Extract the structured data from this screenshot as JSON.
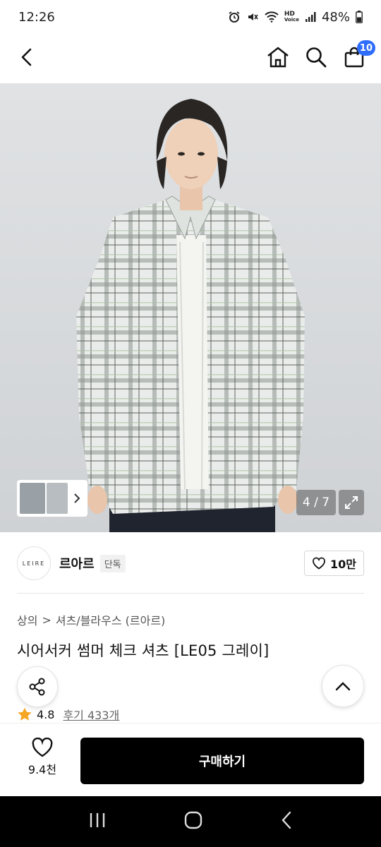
{
  "status_bar": {
    "time": "12:26",
    "network": "HD",
    "network_sub": "Voice",
    "battery": "48%"
  },
  "header": {
    "cart_count": "10"
  },
  "gallery": {
    "counter": "4 / 7"
  },
  "brand": {
    "name": "르아르",
    "logo_text": "LEIRE",
    "badge": "단독",
    "likes": "10만"
  },
  "breadcrumb": {
    "category": "상의",
    "separator": ">",
    "subcategory": "셔츠/블라우스 (르아르)"
  },
  "product": {
    "title": "시어서커 썸머 체크 셔츠 [LE05 그레이]"
  },
  "rating": {
    "score": "4.8",
    "reviews": "후기 433개"
  },
  "bottom": {
    "wish_count": "9.4천",
    "buy_label": "구매하기"
  },
  "colors": {
    "accent": "#2f6dff",
    "star": "#f5a623"
  }
}
